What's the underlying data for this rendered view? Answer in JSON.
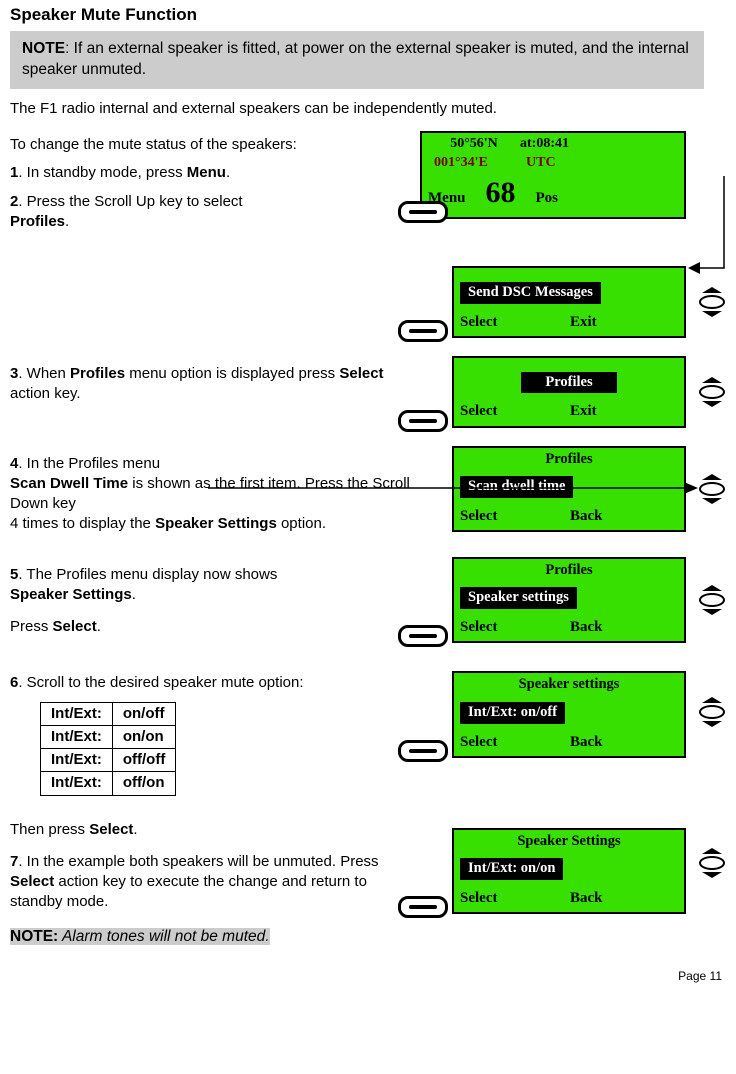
{
  "title": "Speaker Mute Function",
  "note": {
    "label": "NOTE",
    "text": ": If an external speaker is fitted, at power on the external speaker is muted, and the internal speaker unmuted."
  },
  "intro": "The F1 radio internal and external speakers can be independently muted.",
  "intro2": "To change the mute status of the speakers:",
  "step1_a": "1",
  "step1_b": ". In standby mode, press ",
  "step1_c": "Menu",
  "step1_d": ".",
  "step2_a": "2",
  "step2_b": ". Press the Scroll Up key to select ",
  "step2_c": "Profiles",
  "step2_d": ".",
  "step3_a": "3",
  "step3_b": ". When ",
  "step3_c": "Profiles",
  "step3_d": " menu option is displayed press ",
  "step3_e": "Select",
  "step3_f": " action key.",
  "step4_a": "4",
  "step4_b": ". In the Profiles menu",
  "step4_c": "Scan Dwell Time",
  "step4_d": " is shown as the first item. Press the Scroll Down key",
  "step4_e": "4 times to display the ",
  "step4_f": "Speaker Settings",
  "step4_g": " option.",
  "step5_a": "5",
  "step5_b": ". The Profiles menu display now shows ",
  "step5_c": "Speaker Settings",
  "step5_d": ".",
  "step5_e": "Press ",
  "step5_f": "Select",
  "step5_g": ".",
  "step6_a": "6",
  "step6_b": ". Scroll to the desired speaker mute option:",
  "options": [
    {
      "k": "Int/Ext:",
      "v": "on/off"
    },
    {
      "k": "Int/Ext:",
      "v": "on/on"
    },
    {
      "k": "Int/Ext:",
      "v": "off/off"
    },
    {
      "k": "Int/Ext:",
      "v": "off/on"
    }
  ],
  "then_press_a": "Then press ",
  "then_press_b": "Select",
  "then_press_c": ".",
  "step7_a": "7",
  "step7_b": ". In the example both speakers will be unmuted. Press ",
  "step7_c": "Select",
  "step7_d": " action key to execute the change and return to standby mode.",
  "note2_a": "NOTE:",
  "note2_b": " Alarm tones will not be muted.",
  "lcd1": {
    "lat": "50°56'N",
    "time_lbl": "at:08:41",
    "lon": "001°34'E",
    "utc": "UTC",
    "menu": "Menu",
    "ch": "68",
    "pos": "Pos"
  },
  "screen_send": {
    "hl": "Send DSC Messages",
    "l": "Select",
    "r": "Exit"
  },
  "screen_profiles_sel": {
    "hl": "Profiles",
    "l": "Select",
    "r": "Exit"
  },
  "screen_scan": {
    "hdr": "Profiles",
    "hl": "Scan dwell time",
    "l": "Select",
    "r": "Back"
  },
  "screen_spk": {
    "hdr": "Profiles",
    "hl": "Speaker settings",
    "l": "Select",
    "r": "Back"
  },
  "screen_opt1": {
    "hdr": "Speaker settings",
    "hl": "Int/Ext: on/off",
    "l": "Select",
    "r": "Back"
  },
  "screen_opt2": {
    "hdr": "Speaker Settings",
    "hl": "Int/Ext: on/on",
    "l": "Select",
    "r": "Back"
  },
  "page": "Page 11"
}
